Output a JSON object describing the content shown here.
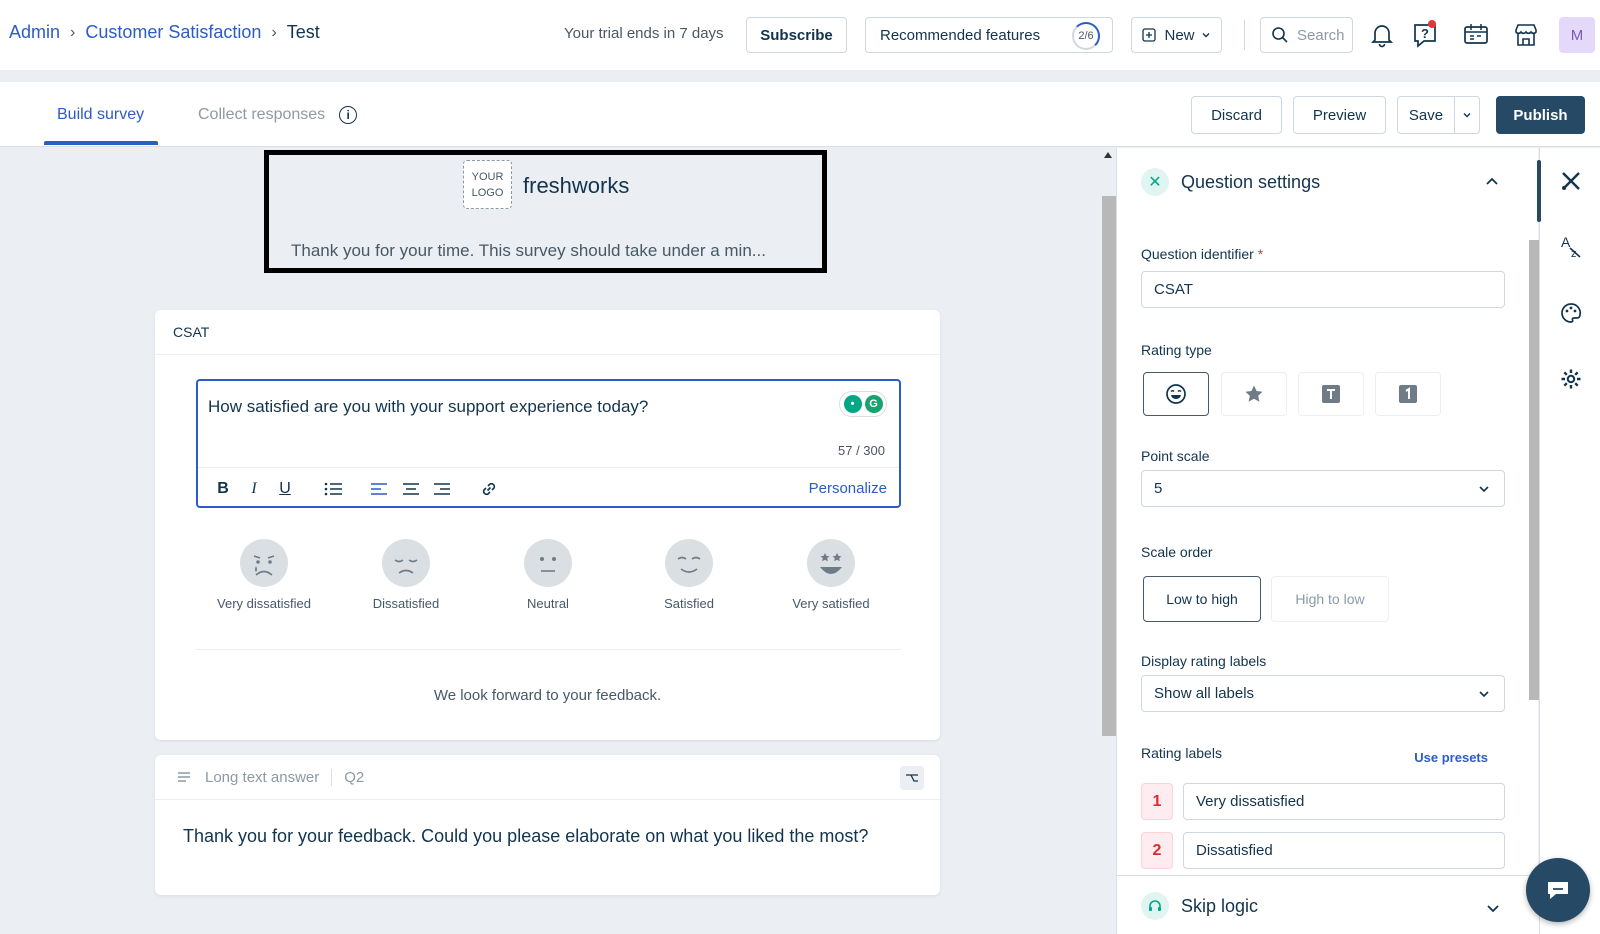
{
  "breadcrumb": {
    "root": "Admin",
    "section": "Customer Satisfaction",
    "current": "Test"
  },
  "topbar": {
    "trial_text": "Your trial ends in 7 days",
    "subscribe_label": "Subscribe",
    "recommended_label": "Recommended features",
    "recommended_progress": "2/6",
    "new_label": "New",
    "search_placeholder": "Search",
    "avatar_initial": "M"
  },
  "tabs": {
    "build": "Build survey",
    "collect": "Collect responses"
  },
  "actions": {
    "discard": "Discard",
    "preview": "Preview",
    "save": "Save",
    "publish": "Publish"
  },
  "survey_header": {
    "logo_text_line1": "YOUR",
    "logo_text_line2": "LOGO",
    "brand": "freshworks",
    "intro": "Thank you for your time. This survey should take under a min..."
  },
  "csat_card": {
    "label": "CSAT",
    "question": "How satisfied are you with your support experience today?",
    "char_count": "57 / 300",
    "personalize": "Personalize",
    "ratings": [
      "Very dissatisfied",
      "Dissatisfied",
      "Neutral",
      "Satisfied",
      "Very satisfied"
    ],
    "footer": "We look forward to your feedback."
  },
  "long_text_card": {
    "type_label": "Long text answer",
    "question_id": "Q2",
    "question": "Thank you for your feedback. Could you please elaborate on what you liked the most?"
  },
  "settings": {
    "title": "Question settings",
    "identifier_label": "Question identifier",
    "identifier_required": "*",
    "identifier_value": "CSAT",
    "rating_type_label": "Rating type",
    "point_scale_label": "Point scale",
    "point_scale_value": "5",
    "scale_order_label": "Scale order",
    "scale_order_low": "Low to high",
    "scale_order_high": "High to low",
    "display_labels_label": "Display rating labels",
    "display_labels_value": "Show all labels",
    "rating_labels_label": "Rating labels",
    "use_presets": "Use presets",
    "rating_labels": [
      {
        "num": "1",
        "text": "Very dissatisfied"
      },
      {
        "num": "2",
        "text": "Dissatisfied"
      }
    ],
    "skip_logic": "Skip logic"
  },
  "colors": {
    "primary": "#2c5cc5",
    "publish_bg": "#264966",
    "teal": "#00a886"
  }
}
